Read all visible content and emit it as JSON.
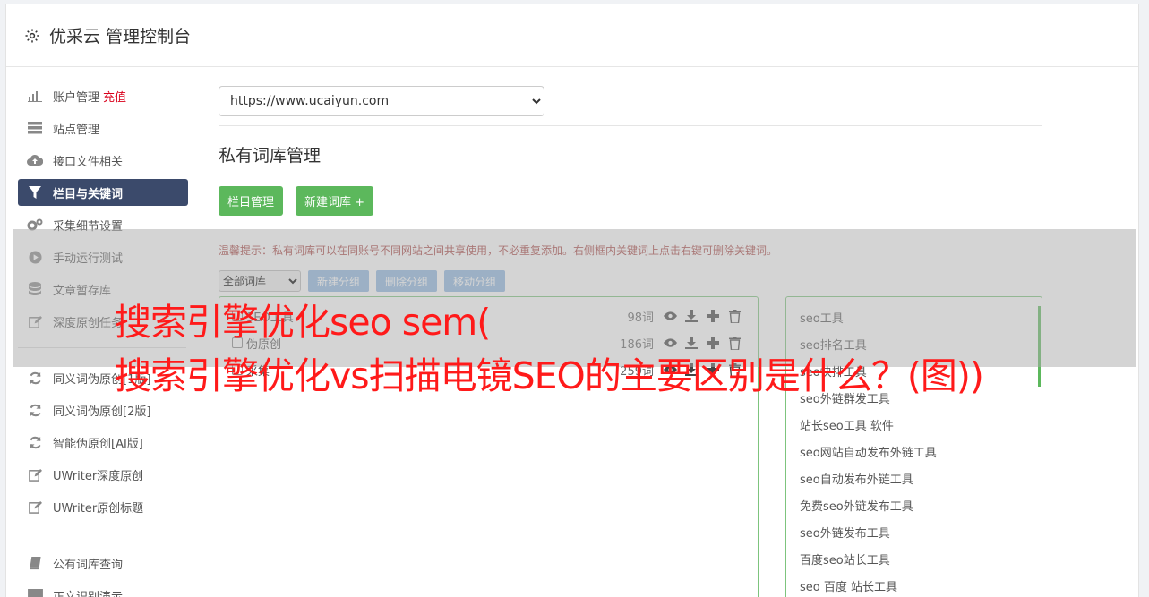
{
  "header": {
    "title": "优采云 管理控制台"
  },
  "sidebar": {
    "items": [
      {
        "label": "账户管理",
        "badge": "充值",
        "icon": "bar-chart-icon"
      },
      {
        "label": "站点管理",
        "icon": "server-icon"
      },
      {
        "label": "接口文件相关",
        "icon": "cloud-upload-icon"
      },
      {
        "label": "栏目与关键词",
        "icon": "filter-icon",
        "active": true
      },
      {
        "label": "采集细节设置",
        "icon": "cogs-icon"
      },
      {
        "label": "手动运行测试",
        "icon": "play-circle-icon"
      },
      {
        "label": "文章暂存库",
        "icon": "database-icon"
      },
      {
        "label": "深度原创任务",
        "icon": "edit-icon"
      }
    ],
    "items2": [
      {
        "label": "同义词伪原创[1版]",
        "icon": "refresh-icon"
      },
      {
        "label": "同义词伪原创[2版]",
        "icon": "refresh-icon"
      },
      {
        "label": "智能伪原创[AI版]",
        "icon": "refresh-icon"
      },
      {
        "label": "UWriter深度原创",
        "icon": "edit-icon"
      },
      {
        "label": "UWriter原创标题",
        "icon": "edit-icon"
      }
    ],
    "items3": [
      {
        "label": "公有词库查询",
        "icon": "book-icon"
      },
      {
        "label": "正文识别演示",
        "icon": "monitor-icon"
      }
    ]
  },
  "main": {
    "site_select": "https://www.ucaiyun.com",
    "section_title": "私有词库管理",
    "btn_column": "栏目管理",
    "btn_new_lib": "新建词库 +",
    "tip": "温馨提示：私有词库可以在同账号不同网站之间共享使用，不必重复添加。右侧框内关键词上点击右键可删除关键词。",
    "category_select": "全部词库",
    "btn_new_group": "新建分组",
    "btn_delete_group": "删除分组",
    "btn_move_group": "移动分组",
    "libs": [
      {
        "name": "SEO工具",
        "count": "98词"
      },
      {
        "name": "伪原创",
        "count": "186词"
      },
      {
        "name": "采集",
        "count": "259词"
      }
    ],
    "keywords": [
      "seo工具",
      "seo排名工具",
      "seo快排工具",
      "seo外链群发工具",
      "站长seo工具 软件",
      "seo网站自动发布外链工具",
      "seo自动发布外链工具",
      "免费seo外链发布工具",
      "seo外链发布工具",
      "百度seo站长工具",
      "seo 百度 站长工具"
    ]
  },
  "overlay": {
    "line1": "搜索引擎优化seo sem(",
    "line2": "搜索引擎优化vs扫描电镜SEO的主要区别是什么？(图))"
  }
}
